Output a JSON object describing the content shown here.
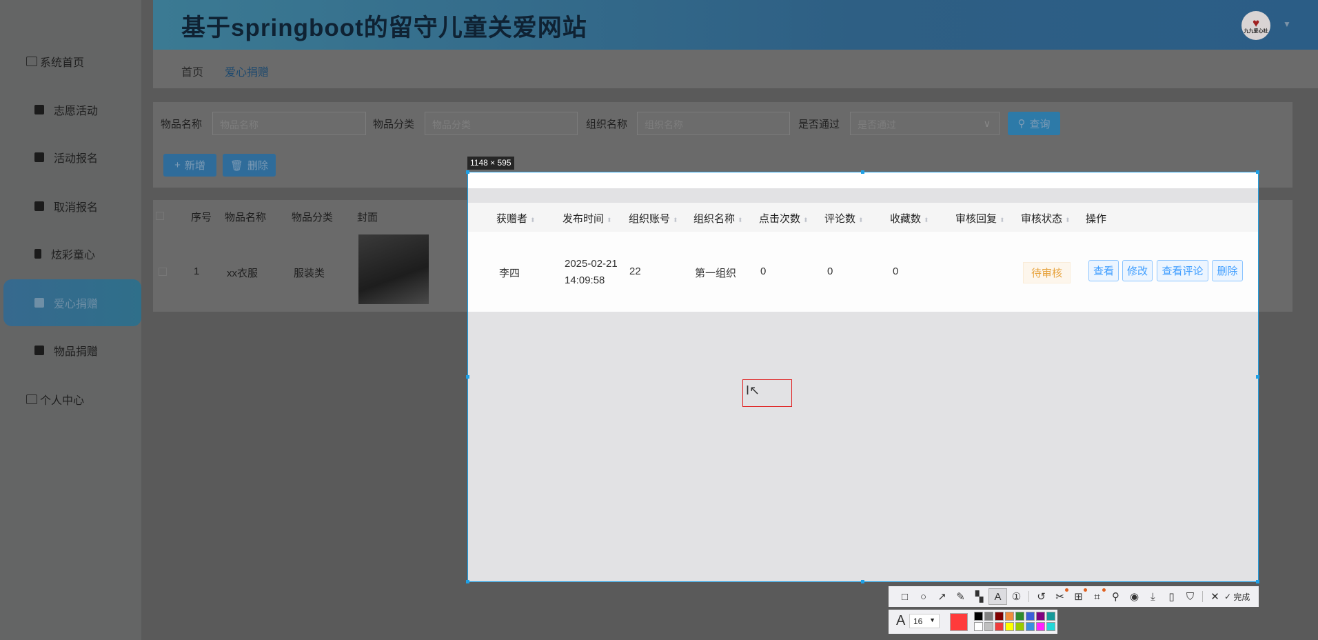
{
  "header": {
    "title": "基于springboot的留守儿童关爱网站",
    "avatar_text": "九九爱心社"
  },
  "sidebar": {
    "items": [
      {
        "label": "系统首页",
        "icon": "home-icon"
      },
      {
        "label": "志愿活动",
        "icon": "briefcase-icon"
      },
      {
        "label": "活动报名",
        "icon": "book-icon"
      },
      {
        "label": "取消报名",
        "icon": "chart-icon"
      },
      {
        "label": "炫彩童心",
        "icon": "flag-icon"
      },
      {
        "label": "爱心捐赠",
        "icon": "clipboard-icon",
        "active": true
      },
      {
        "label": "物品捐赠",
        "icon": "clipboard-x-icon"
      },
      {
        "label": "个人中心",
        "icon": "wallet-icon"
      }
    ]
  },
  "breadcrumb": {
    "home": "首页",
    "current": "爱心捐赠"
  },
  "search": {
    "f1_label": "物品名称",
    "f1_placeholder": "物品名称",
    "f2_label": "物品分类",
    "f2_placeholder": "物品分类",
    "f3_label": "组织名称",
    "f3_placeholder": "组织名称",
    "f4_label": "是否通过",
    "f4_placeholder": "是否通过",
    "query": "查询",
    "add": "新增",
    "delete": "删除"
  },
  "table": {
    "left_headers": [
      "序号",
      "物品名称",
      "物品分类",
      "封面"
    ],
    "headers": [
      "获赠者",
      "发布时间",
      "组织账号",
      "组织名称",
      "点击次数",
      "评论数",
      "收藏数",
      "审核回复",
      "审核状态",
      "操作"
    ],
    "row": {
      "index": "1",
      "item_name": "xx衣服",
      "category": "服装类",
      "recipient": "李四",
      "date": "2025-02-21",
      "time": "14:09:58",
      "org_account": "22",
      "org_name": "第一组织",
      "clicks": "0",
      "comments": "0",
      "favorites": "0",
      "reply": "",
      "status": "待审核",
      "actions": [
        "查看",
        "修改",
        "查看评论",
        "删除"
      ]
    }
  },
  "capture": {
    "size_label": "1148 × 595",
    "font_size": "16",
    "done": "完成",
    "current_color": "#ff3b3b",
    "colors": [
      "#000000",
      "#808080",
      "#800000",
      "#f08c3c",
      "#2e8b2e",
      "#3a5fd8",
      "#800080",
      "#159a9a",
      "#ffffff",
      "#c0c0c0",
      "#f03c3c",
      "#ffff00",
      "#99cc00",
      "#3a8fe0",
      "#ff22ff",
      "#22d8d8"
    ]
  }
}
